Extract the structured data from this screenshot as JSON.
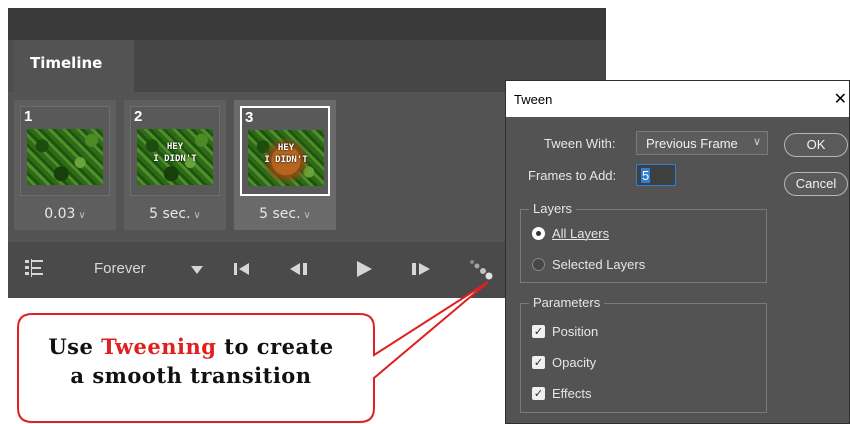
{
  "timeline": {
    "tab_label": "Timeline",
    "frames": [
      {
        "number": "1",
        "delay": "0.03",
        "overlay": "",
        "selected": false
      },
      {
        "number": "2",
        "delay": "5 sec.",
        "overlay": "HEY\nI DIDN'T",
        "selected": false
      },
      {
        "number": "3",
        "delay": "5 sec.",
        "overlay": "HEY\nI DIDN'T",
        "selected": true
      }
    ],
    "loop_label": "Forever",
    "icons": {
      "convert": "convert-to-video-timeline-icon",
      "loop_dropdown": "triangle-down-icon",
      "first": "select-first-frame-icon",
      "prev": "select-previous-frame-icon",
      "play": "play-icon",
      "next": "select-next-frame-icon",
      "tween": "tween-icon"
    }
  },
  "dialog": {
    "title": "Tween",
    "close": "✕",
    "tween_with_label": "Tween With:",
    "tween_with_value": "Previous Frame",
    "frames_to_add_label": "Frames to Add:",
    "frames_to_add_value": "5",
    "ok_label": "OK",
    "cancel_label": "Cancel",
    "layers": {
      "title": "Layers",
      "options": [
        "All Layers",
        "Selected Layers"
      ],
      "selected": "All Layers"
    },
    "parameters": {
      "title": "Parameters",
      "options": [
        {
          "label": "Position",
          "checked": true
        },
        {
          "label": "Opacity",
          "checked": true
        },
        {
          "label": "Effects",
          "checked": true
        }
      ]
    }
  },
  "callout": {
    "line1_pre": "Use",
    "line1_highlight": "Tweening",
    "line1_post": "to create",
    "line2": "a smooth transition",
    "accent_color": "#e02020"
  }
}
